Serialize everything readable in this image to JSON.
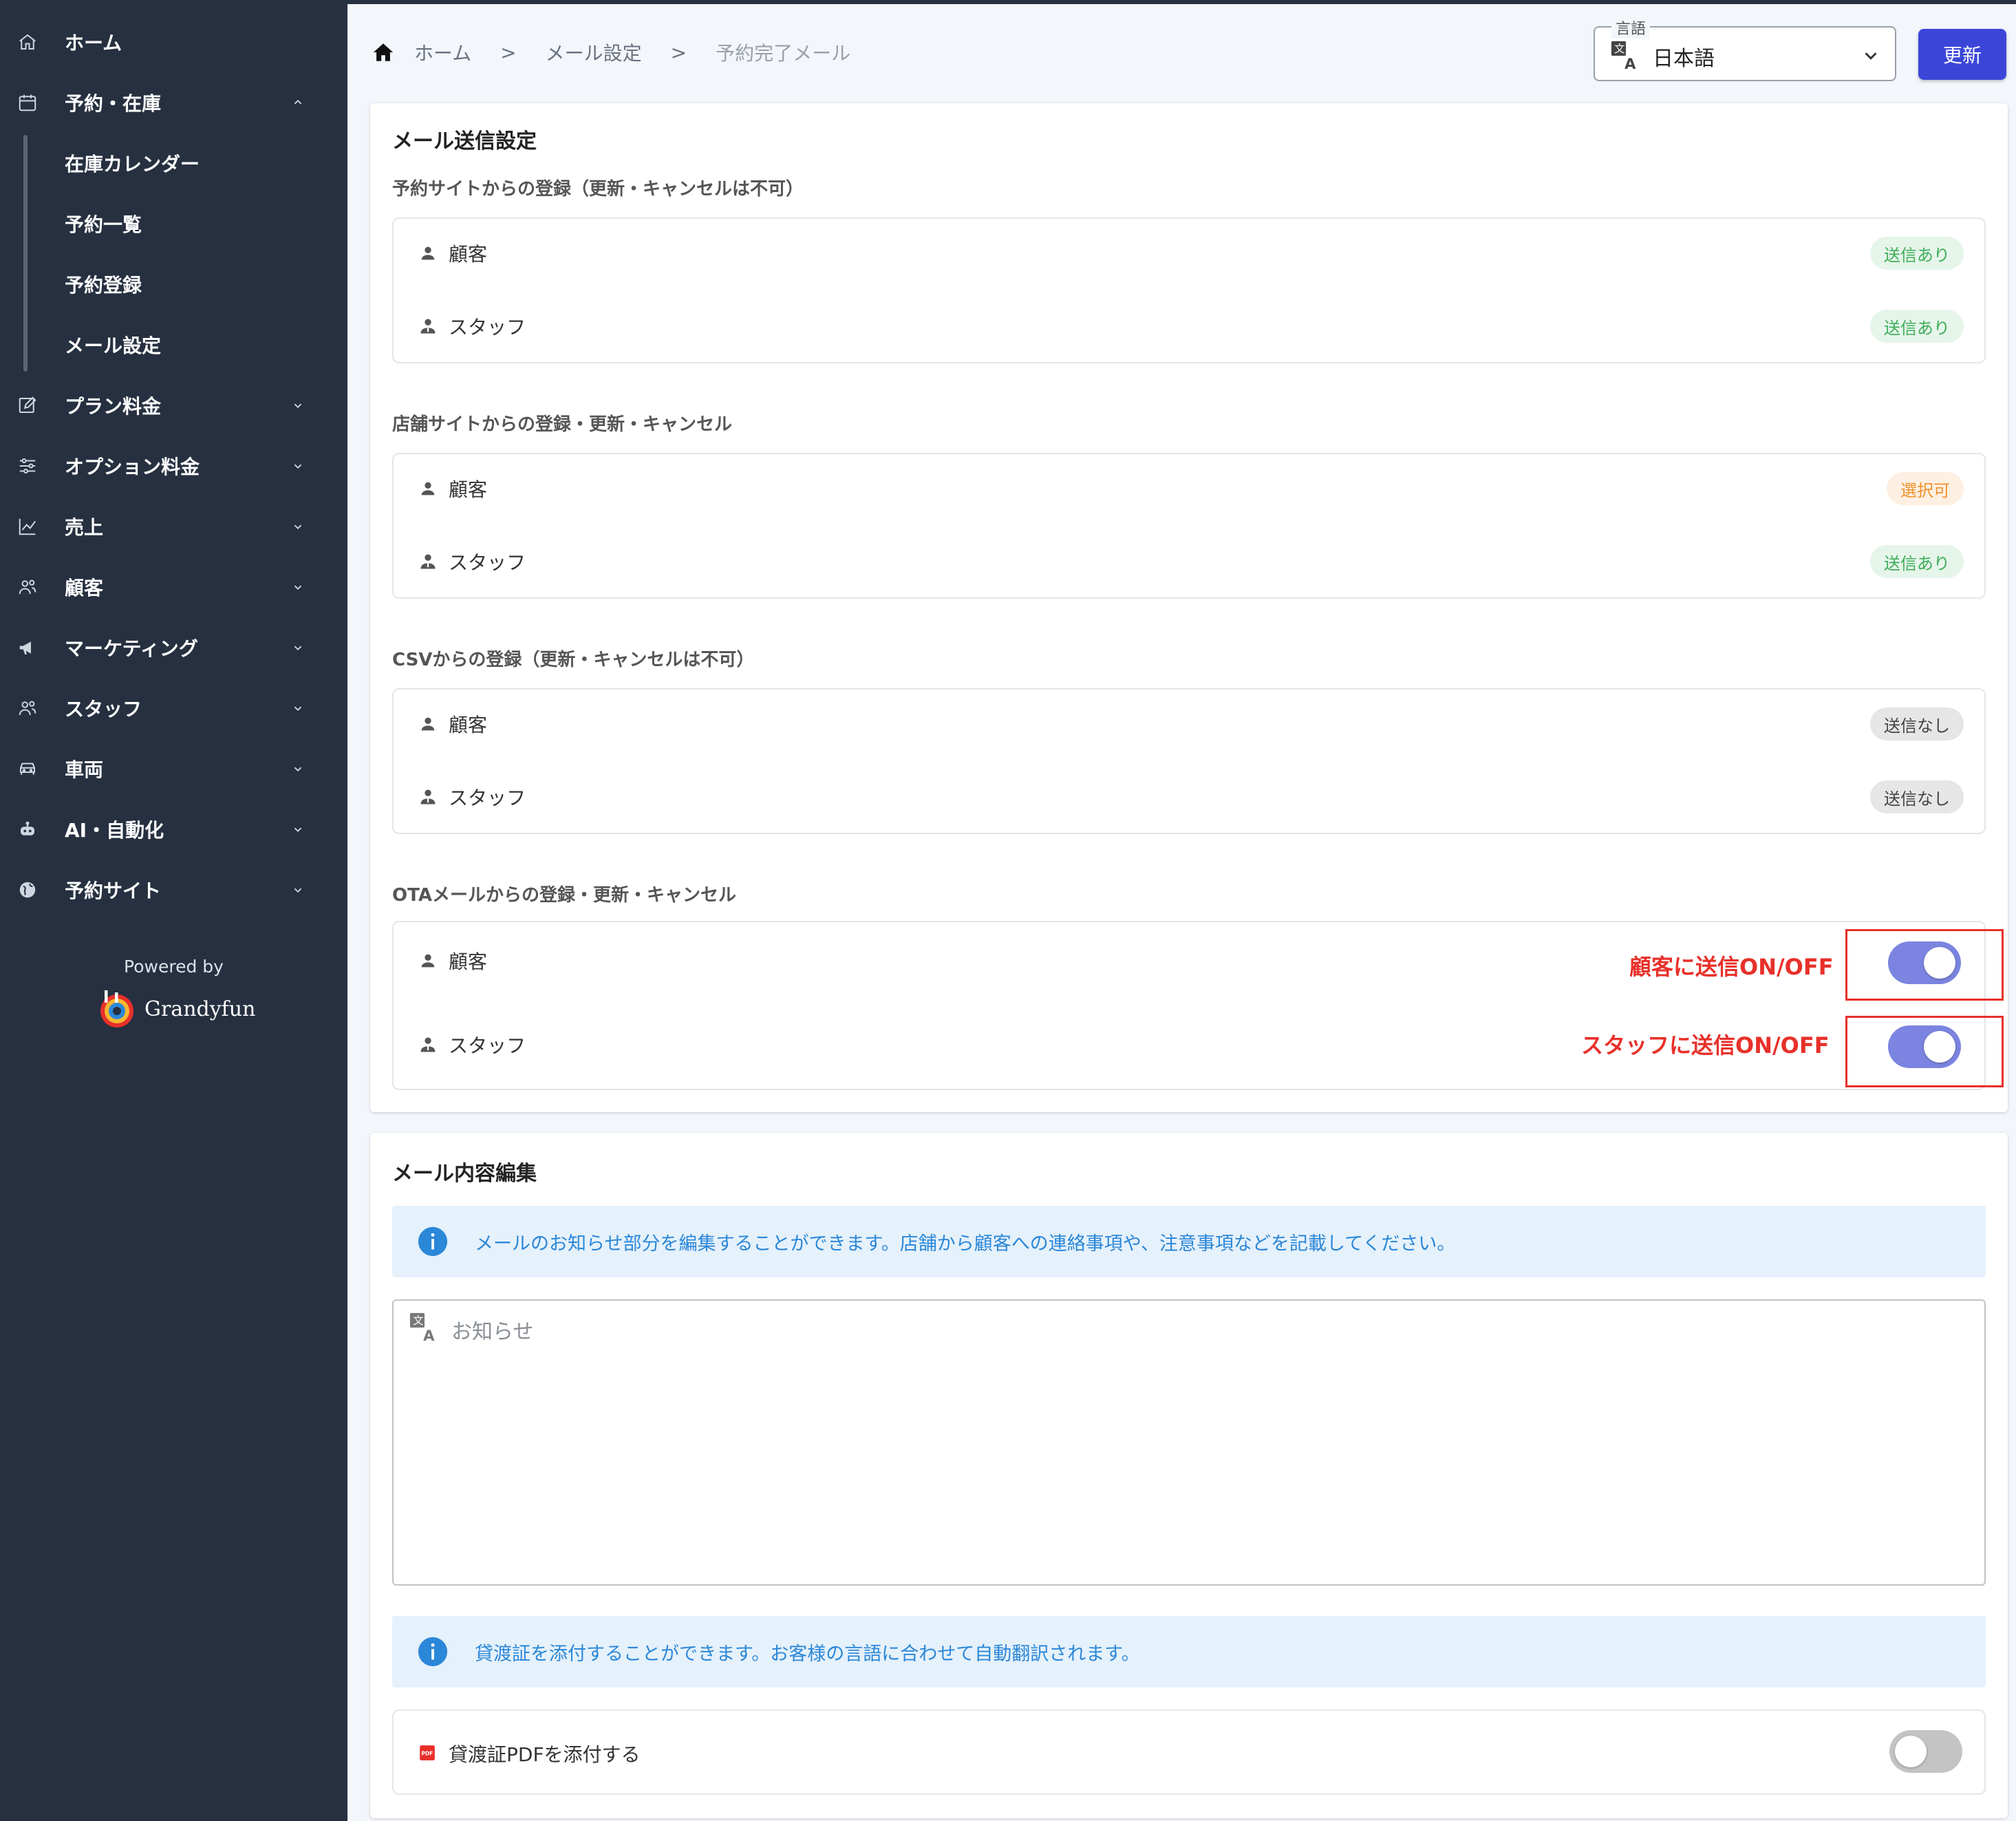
{
  "sidebar": {
    "items": [
      {
        "label": "ホーム",
        "icon": "home-icon"
      },
      {
        "label": "予約・在庫",
        "icon": "calendar-icon",
        "expanded": true
      },
      {
        "label": "プラン料金",
        "icon": "edit-icon"
      },
      {
        "label": "オプション料金",
        "icon": "sliders-icon"
      },
      {
        "label": "売上",
        "icon": "chart-icon"
      },
      {
        "label": "顧客",
        "icon": "people-icon"
      },
      {
        "label": "マーケティング",
        "icon": "megaphone-icon"
      },
      {
        "label": "スタッフ",
        "icon": "people-icon"
      },
      {
        "label": "車両",
        "icon": "car-icon"
      },
      {
        "label": "AI・自動化",
        "icon": "robot-icon"
      },
      {
        "label": "予約サイト",
        "icon": "globe-icon"
      }
    ],
    "subitems": [
      "在庫カレンダー",
      "予約一覧",
      "予約登録",
      "メール設定"
    ],
    "powered_by": "Powered by",
    "brand": "Grandyfun"
  },
  "breadcrumb": {
    "items": [
      "ホーム",
      "メール設定",
      "予約完了メール"
    ],
    "separator": ">"
  },
  "language": {
    "legend": "言語",
    "value": "日本語"
  },
  "update_label": "更新",
  "send_settings": {
    "title": "メール送信設定",
    "groups": [
      {
        "title": "予約サイトからの登録（更新・キャンセルは不可）",
        "rows": [
          {
            "label": "顧客",
            "badge": "送信あり",
            "status": "green"
          },
          {
            "label": "スタッフ",
            "badge": "送信あり",
            "status": "green"
          }
        ]
      },
      {
        "title": "店舗サイトからの登録・更新・キャンセル",
        "rows": [
          {
            "label": "顧客",
            "badge": "選択可",
            "status": "orange"
          },
          {
            "label": "スタッフ",
            "badge": "送信あり",
            "status": "green"
          }
        ]
      },
      {
        "title": "CSVからの登録（更新・キャンセルは不可）",
        "rows": [
          {
            "label": "顧客",
            "badge": "送信なし",
            "status": "gray"
          },
          {
            "label": "スタッフ",
            "badge": "送信なし",
            "status": "gray"
          }
        ]
      },
      {
        "title": "OTAメールからの登録・更新・キャンセル",
        "rows": [
          {
            "label": "顧客",
            "toggle": true,
            "annotation": "顧客に送信ON/OFF"
          },
          {
            "label": "スタッフ",
            "toggle": true,
            "annotation": "スタッフに送信ON/OFF"
          }
        ]
      }
    ]
  },
  "content_edit": {
    "title": "メール内容編集",
    "info1": "メールのお知らせ部分を編集することができます。店舗から顧客への連絡事項や、注意事項などを記載してください。",
    "notice_placeholder": "お知らせ",
    "info2": "貸渡証を添付することができます。お客様の言語に合わせて自動翻訳されます。",
    "attach_label": "貸渡証PDFを添付する",
    "attach_on": false
  },
  "colors": {
    "sidebar_bg": "#263040",
    "primary": "#3b46d9",
    "toggle_on": "#7b84e0",
    "annotation": "#e8302a",
    "info_text": "#2b87d8"
  }
}
